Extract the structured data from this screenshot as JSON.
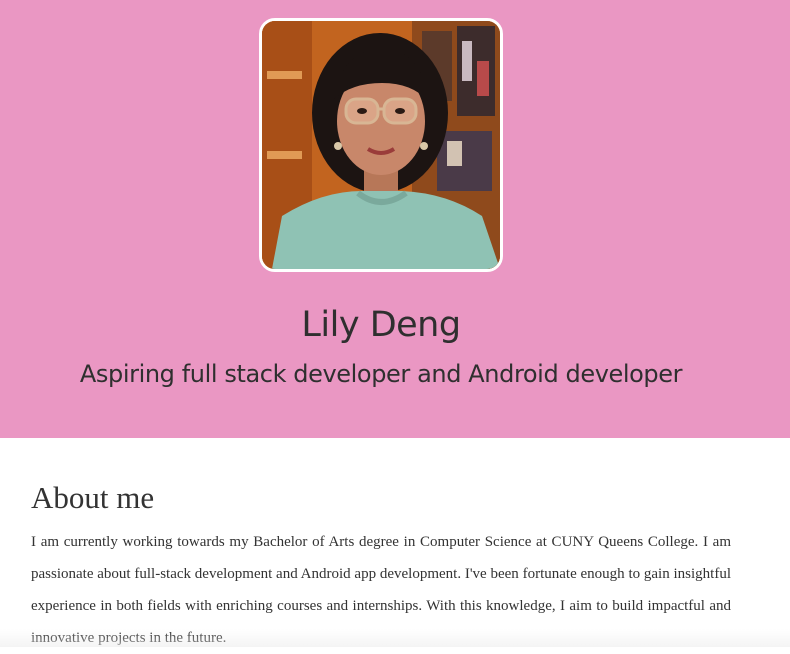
{
  "profile": {
    "photo_alt": "Lily Deng",
    "name": "Lily Deng",
    "tagline": "Aspiring full stack developer and Android developer"
  },
  "about": {
    "heading": "About me",
    "paragraph": "I am currently working towards my Bachelor of Arts degree in Computer Science at CUNY Queens College. I am passionate about full-stack development and Android app development. I've been fortunate enough to gain insightful experience in both fields with enriching courses and internships. With this knowledge, I aim to build impactful and innovative projects in the future."
  },
  "colors": {
    "hero_background": "#ea97c3",
    "text": "#333333"
  }
}
